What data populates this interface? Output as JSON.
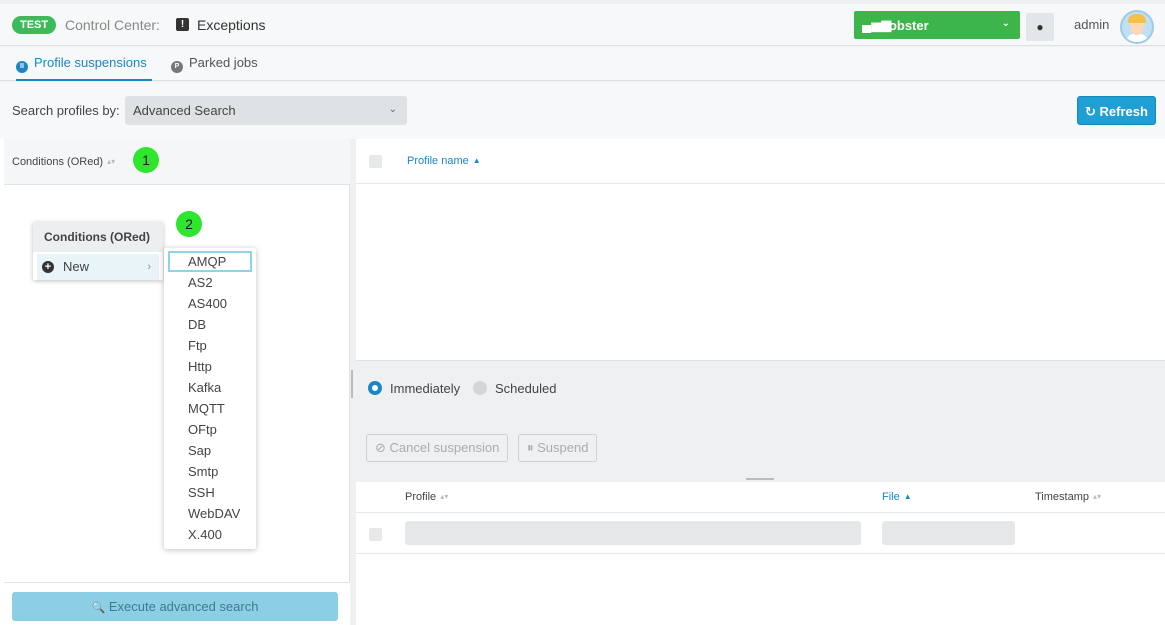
{
  "header": {
    "env_badge": "TEST",
    "app_title": "Control Center:",
    "page_icon": "exclamation-icon",
    "page_icon_glyph": "!",
    "page_title": "Exceptions",
    "instance": "Lobster",
    "instance_icon_glyph": "▄▅▆",
    "dropdown_glyph": "⌄",
    "chat_glyph": "●",
    "user": "admin"
  },
  "tabs": [
    {
      "label": "Profile suspensions",
      "icon_glyph": "II",
      "active": true
    },
    {
      "label": "Parked jobs",
      "icon_glyph": "P",
      "active": false
    }
  ],
  "search": {
    "label": "Search profiles by:",
    "value": "Advanced Search",
    "dropdown_glyph": "⌄",
    "refresh_icon": "↻",
    "refresh_label": "Refresh"
  },
  "left": {
    "header": "Conditions (ORed)",
    "sort_glyph": "▴▾",
    "execute_icon": "🔍",
    "execute_label": "Execute advanced search"
  },
  "callouts": [
    "1",
    "2"
  ],
  "context_menu": {
    "title": "Conditions (ORed)",
    "item_icon": "+",
    "item": "New",
    "item_arrow": "›"
  },
  "submenu": {
    "items": [
      "AMQP",
      "AS2",
      "AS400",
      "DB",
      "Ftp",
      "Http",
      "Kafka",
      "MQTT",
      "OFtp",
      "Sap",
      "Smtp",
      "SSH",
      "WebDAV",
      "X.400"
    ],
    "selected": "AMQP"
  },
  "profile_table": {
    "column": "Profile name",
    "sort_glyph": "▲"
  },
  "controls": {
    "radio_immediately": "Immediately",
    "radio_scheduled": "Scheduled",
    "cancel_icon": "⊘",
    "cancel_label": "Cancel suspension",
    "suspend_icon": "⏸",
    "suspend_label": "Suspend"
  },
  "jobs_table": {
    "col_profile": "Profile",
    "col_file": "File",
    "col_timestamp": "Timestamp",
    "sort_glyph": "▴▾",
    "sort_active_glyph": "▲"
  },
  "colors": {
    "accent": "#1a86c8",
    "instance": "#3cb54a",
    "env_badge": "#3dbb5a",
    "callout": "#2ee62e"
  }
}
